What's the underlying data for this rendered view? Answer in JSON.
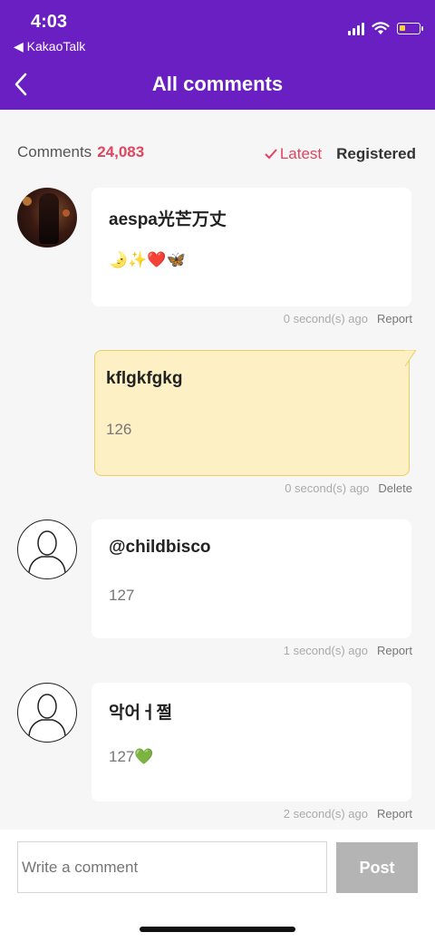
{
  "status_bar": {
    "time": "4:03",
    "back_app": "◀ KakaoTalk"
  },
  "header": {
    "title": "All comments"
  },
  "summary": {
    "label": "Comments",
    "count": "24,083",
    "sort_latest": "Latest",
    "sort_registered": "Registered"
  },
  "comments": [
    {
      "author": "aespa光芒万丈",
      "text": "🌛✨❤️🦋",
      "time": "0 second(s) ago",
      "action": "Report"
    },
    {
      "author": "kflgkfgkg",
      "text": "126",
      "time": "0 second(s) ago",
      "action": "Delete"
    },
    {
      "author": "@childbisco",
      "text": "127",
      "time": "1 second(s) ago",
      "action": "Report"
    },
    {
      "author": "악어ㅓ쩔",
      "text": "127💚",
      "time": "2 second(s) ago",
      "action": "Report"
    }
  ],
  "composer": {
    "placeholder": "Write a comment",
    "post_label": "Post"
  },
  "colors": {
    "header": "#6a1fc2",
    "accent": "#e0455f",
    "my_bubble": "#fcf0c4"
  }
}
